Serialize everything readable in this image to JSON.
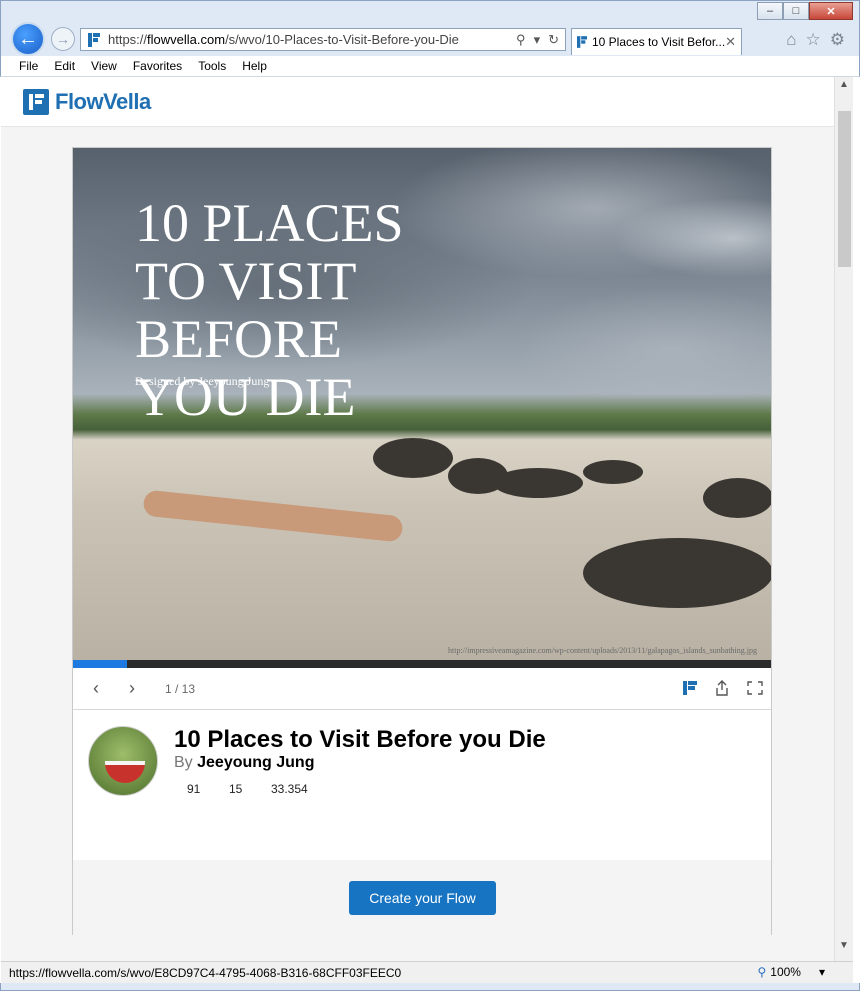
{
  "browser": {
    "url": "https://flowvella.com/s/wvo/10-Places-to-Visit-Before-you-Die",
    "url_host": "flowvella.com",
    "url_prefix": "https://",
    "url_path": "/s/wvo/10-Places-to-Visit-Before-you-Die",
    "tab_title": "10 Places to Visit Befor...",
    "menu": [
      "File",
      "Edit",
      "View",
      "Favorites",
      "Tools",
      "Help"
    ],
    "status_url": "https://flowvella.com/s/wvo/E8CD97C4-4795-4068-B316-68CFF03FEEC0",
    "zoom": "100%"
  },
  "site": {
    "logo_text": "FlowVella",
    "brand_color": "#1f6fb3"
  },
  "slide": {
    "title": "10 PLACES TO VISIT BEFORE YOU DIE",
    "subtitle": "Designed by Jeeyoung Jung",
    "credit": "http://impressiveamagazine.com/wp-content/uploads/2013/11/galapagos_islands_sunbathing.jpg",
    "current": 1,
    "total": 13,
    "counter_text": "1 / 13",
    "progress": 0.077
  },
  "flow": {
    "title": "10 Places to Visit Before you Die",
    "by_label": "By",
    "author": "Jeeyoung Jung",
    "stats": [
      "91",
      "15",
      "33.354"
    ]
  },
  "cta": {
    "label": "Create your Flow",
    "color": "#1774c3"
  }
}
